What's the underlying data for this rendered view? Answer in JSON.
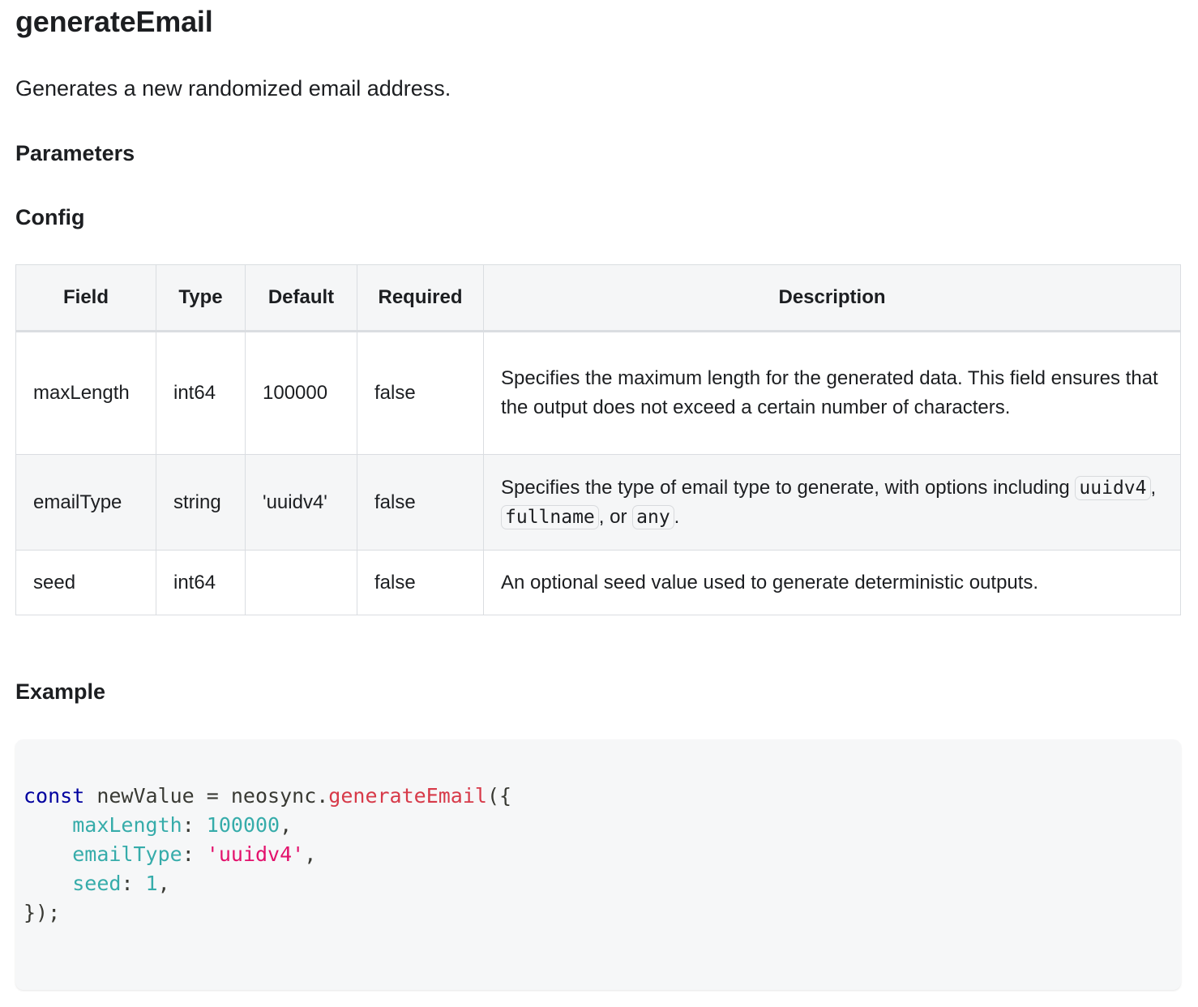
{
  "doc": {
    "title": "generateEmail",
    "description": "Generates a new randomized email address.",
    "parameters_heading": "Parameters",
    "config_heading": "Config",
    "example_heading": "Example"
  },
  "table": {
    "headers": [
      "Field",
      "Type",
      "Default",
      "Required",
      "Description"
    ],
    "rows": [
      {
        "field": "maxLength",
        "type": "int64",
        "default": "100000",
        "required": "false",
        "description": "Specifies the maximum length for the generated data. This field ensures that the output does not exceed a certain number of characters."
      },
      {
        "field": "emailType",
        "type": "string",
        "default": "'uuidv4'",
        "required": "false",
        "description_prefix": "Specifies the type of email type to generate, with options including ",
        "option_1": "uuidv4",
        "sep_1": ", ",
        "option_2": "fullname",
        "sep_2": ", or ",
        "option_3": "any",
        "description_suffix": "."
      },
      {
        "field": "seed",
        "type": "int64",
        "default": "",
        "required": "false",
        "description": "An optional seed value used to generate deterministic outputs."
      }
    ]
  },
  "code": {
    "kw": "const",
    "var_assign": " newValue = neosync.",
    "fn": "generateEmail",
    "open": "({",
    "indent": "    ",
    "prop_1": "maxLength",
    "colon": ": ",
    "val_1": "100000",
    "prop_2": "emailType",
    "val_2": "'uuidv4'",
    "prop_3": "seed",
    "val_3": "1",
    "comma": ",",
    "close": "});"
  }
}
